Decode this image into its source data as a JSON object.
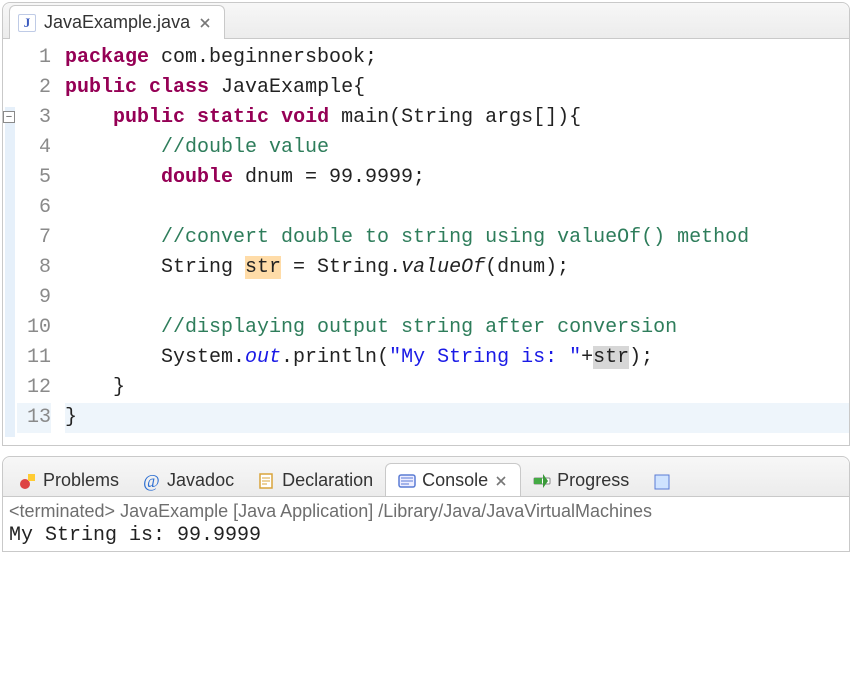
{
  "editor": {
    "tabTitle": "JavaExample.java",
    "lines": {
      "n1": "1",
      "n2": "2",
      "n3": "3",
      "n4": "4",
      "n5": "5",
      "n6": "6",
      "n7": "7",
      "n8": "8",
      "n9": "9",
      "n10": "10",
      "n11": "11",
      "n12": "12",
      "n13": "13"
    },
    "code": {
      "l1": {
        "kw1": "package",
        "rest": " com.beginnersbook;"
      },
      "l2": {
        "kw1": "public",
        "kw2": "class",
        "rest": " JavaExample{"
      },
      "l3": {
        "indent": "    ",
        "kw1": "public",
        "kw2": "static",
        "kw3": "void",
        "rest": " main(String args[]){"
      },
      "l4": {
        "indent": "        ",
        "cm": "//double value"
      },
      "l5": {
        "indent": "        ",
        "kw": "double",
        "rest": " dnum = 99.9999;"
      },
      "l6": "",
      "l7": {
        "indent": "        ",
        "cm": "//convert double to string using valueOf() method"
      },
      "l8": {
        "indent": "        ",
        "a": "String ",
        "hl": "str",
        "b": " = String.",
        "it": "valueOf",
        "c": "(dnum);"
      },
      "l9": "",
      "l10": {
        "indent": "        ",
        "cm": "//displaying output string after conversion"
      },
      "l11": {
        "indent": "        ",
        "a": "System.",
        "sf": "out",
        "b": ".println(",
        "str": "\"My String is: \"",
        "c": "+",
        "hl": "str",
        "d": ");"
      },
      "l12": "    }",
      "l13": "}"
    }
  },
  "tabs": {
    "problems": "Problems",
    "javadoc": "Javadoc",
    "declaration": "Declaration",
    "console": "Console",
    "progress": "Progress"
  },
  "console": {
    "meta": "<terminated> JavaExample [Java Application] /Library/Java/JavaVirtualMachines",
    "output": "My String is: 99.9999"
  }
}
